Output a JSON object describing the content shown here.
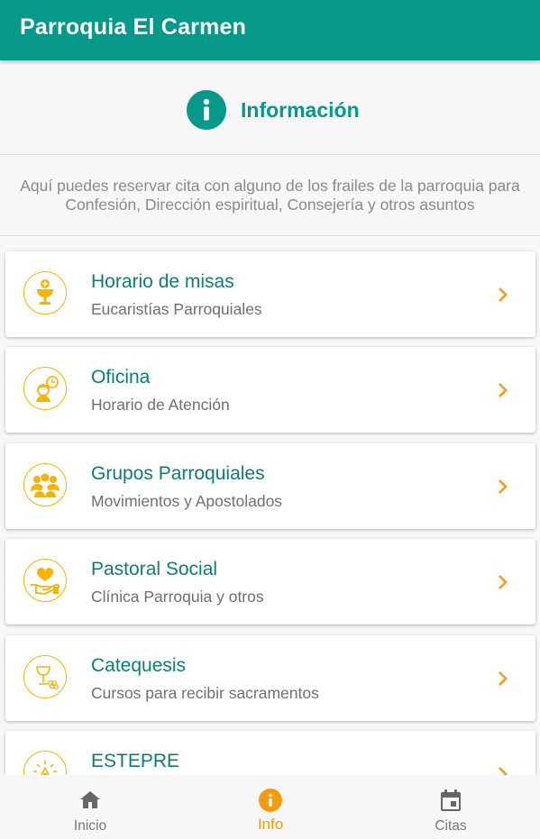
{
  "app": {
    "title": "Parroquia El Carmen",
    "primary": "#069889",
    "accent": "#f39c12",
    "icon_yellow": "#f4b400"
  },
  "header": {
    "title": "Información",
    "icon": "info-icon"
  },
  "description": "Aquí puedes reservar cita con alguno de los frailes de la parroquia para Confesión, Dirección espiritual, Consejería y otros asuntos",
  "items": [
    {
      "title": "Horario de misas",
      "subtitle": "Eucaristías Parroquiales",
      "icon": "chalice-icon"
    },
    {
      "title": "Oficina",
      "subtitle": "Horario de Atención",
      "icon": "office-clock-icon"
    },
    {
      "title": "Grupos Parroquiales",
      "subtitle": "Movimientos y Apostolados",
      "icon": "groups-icon"
    },
    {
      "title": "Pastoral Social",
      "subtitle": "Clínica Parroquia y otros",
      "icon": "heart-hand-icon"
    },
    {
      "title": "Catequesis",
      "subtitle": "Cursos para recibir sacramentos",
      "icon": "catechesis-icon"
    },
    {
      "title": "ESTEPRE",
      "subtitle": "",
      "icon": "estepre-icon"
    }
  ],
  "nav": [
    {
      "label": "Inicio",
      "icon": "home-icon",
      "active": false
    },
    {
      "label": "Info",
      "icon": "info-icon",
      "active": true
    },
    {
      "label": "Citas",
      "icon": "calendar-icon",
      "active": false
    }
  ]
}
